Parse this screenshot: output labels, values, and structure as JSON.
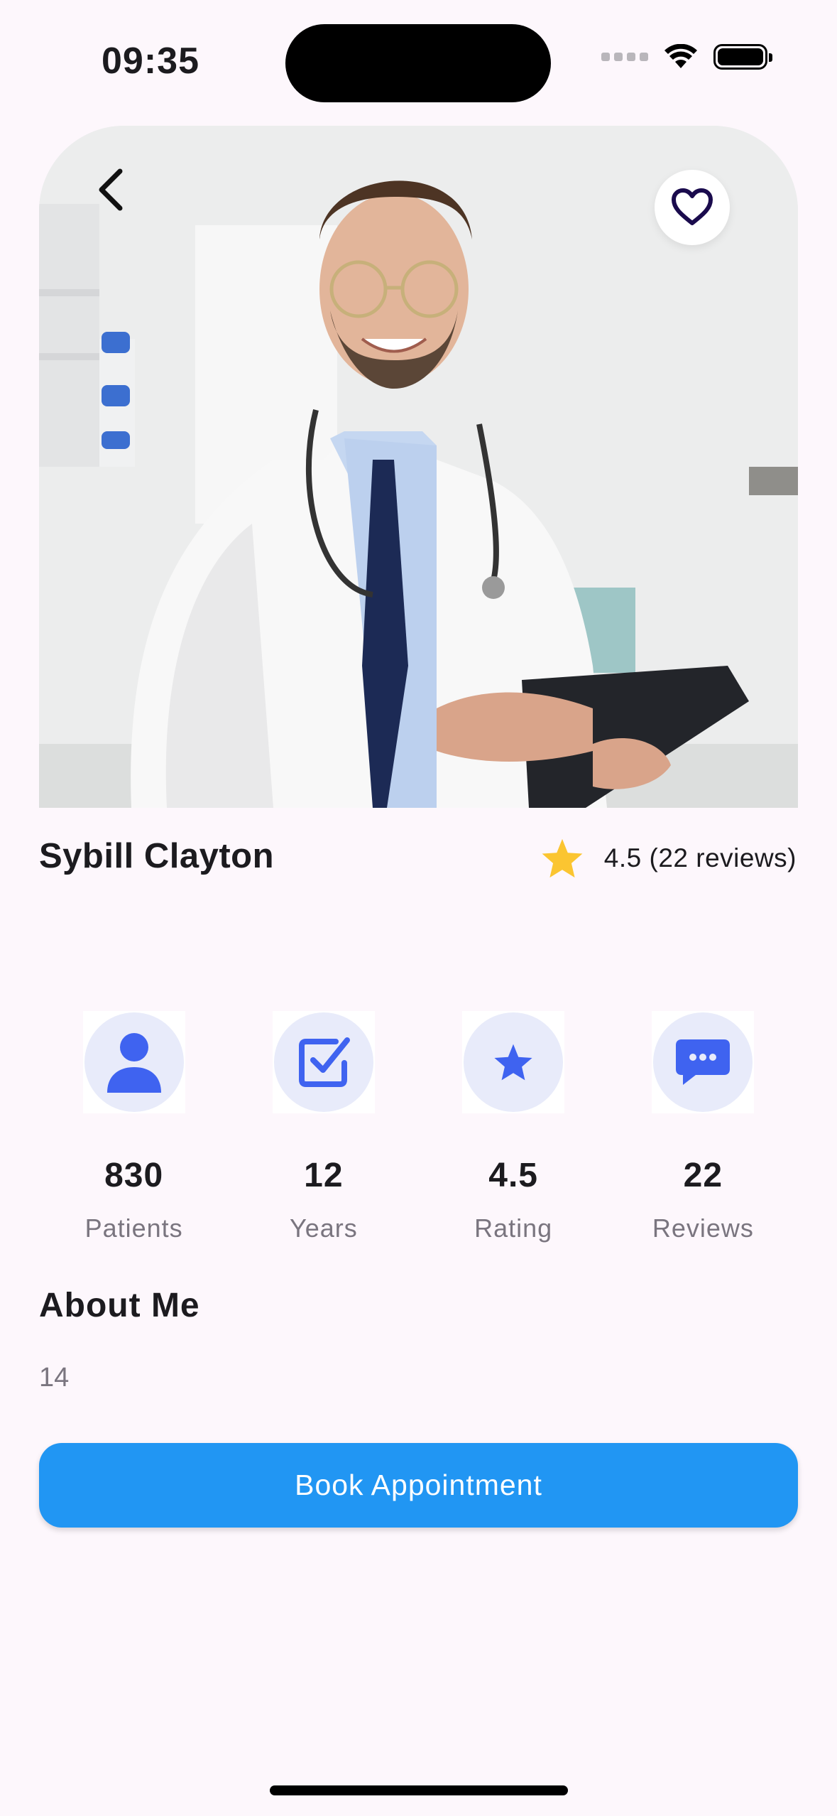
{
  "status_bar": {
    "time": "09:35"
  },
  "doctor": {
    "name": "Sybill Clayton",
    "rating_text": "4.5 (22 reviews)",
    "photo": "doctor-photo"
  },
  "stats": [
    {
      "icon": "person-icon",
      "value": "830",
      "label": "Patients"
    },
    {
      "icon": "checkbox-icon",
      "value": "12",
      "label": "Years"
    },
    {
      "icon": "star-icon",
      "value": "4.5",
      "label": "Rating"
    },
    {
      "icon": "chat-icon",
      "value": "22",
      "label": "Reviews"
    }
  ],
  "about": {
    "title": "About Me",
    "text": "14"
  },
  "actions": {
    "book_label": "Book Appointment"
  },
  "colors": {
    "accent": "#2196f3",
    "icon_blue": "#3f63f0",
    "icon_bg": "#e8ebfa",
    "star": "#fbc531",
    "heart": "#1a0b4d",
    "background": "#fdf7fc"
  }
}
